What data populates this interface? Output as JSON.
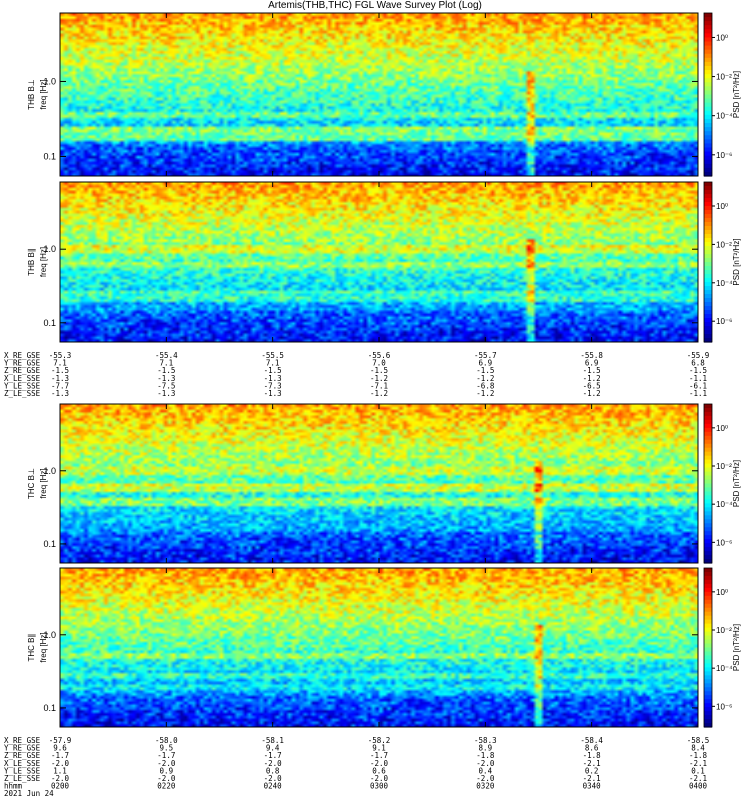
{
  "title": "Artemis(THB,THC) FGL Wave Survey Plot (Log)",
  "chart_data": [
    {
      "type": "heatmap",
      "ylabel": [
        "THB B⊥",
        "freq [Hz]"
      ],
      "colorbar_label": "PSD [nT²/Hz]",
      "y_scale": "log",
      "yticks": [
        "1.0",
        "0.1"
      ],
      "cticks": [
        "10⁰",
        "10⁻²",
        "10⁻⁴",
        "10⁻⁶"
      ]
    },
    {
      "type": "heatmap",
      "ylabel": [
        "THB B∥",
        "freq [Hz]"
      ],
      "colorbar_label": "PSD [nT²/Hz]",
      "y_scale": "log",
      "yticks": [
        "1.0",
        "0.1"
      ],
      "cticks": [
        "10⁰",
        "10⁻²",
        "10⁻⁴",
        "10⁻⁶"
      ]
    },
    {
      "type": "heatmap",
      "ylabel": [
        "THC B⊥",
        "freq [Hz]"
      ],
      "colorbar_label": "PSD [nT²/Hz]",
      "y_scale": "log",
      "yticks": [
        "1.0",
        "0.1"
      ],
      "cticks": [
        "10⁰",
        "10⁻²",
        "10⁻⁴",
        "10⁻⁶"
      ]
    },
    {
      "type": "heatmap",
      "ylabel": [
        "THC B∥",
        "freq [Hz]"
      ],
      "colorbar_label": "PSD [nT²/Hz]",
      "y_scale": "log",
      "yticks": [
        "1.0",
        "0.1"
      ],
      "cticks": [
        "10⁰",
        "10⁻²",
        "10⁻⁴",
        "10⁻⁶"
      ]
    }
  ],
  "ephem_thb": {
    "labels": [
      "X_RE_GSE",
      "Y_RE_GSE",
      "Z_RE_GSE",
      "X_LE_SSE",
      "Y_LE_SSE",
      "Z_LE_SSE"
    ],
    "rows": [
      [
        "-55.3",
        "-55.4",
        "-55.5",
        "-55.6",
        "-55.7",
        "-55.8",
        "-55.9"
      ],
      [
        "7.1",
        "7.1",
        "7.1",
        "7.0",
        "6.9",
        "6.9",
        "6.8"
      ],
      [
        "-1.5",
        "-1.5",
        "-1.5",
        "-1.5",
        "-1.5",
        "-1.5",
        "-1.5"
      ],
      [
        "-1.3",
        "-1.3",
        "-1.3",
        "-1.2",
        "-1.2",
        "-1.2",
        "-1.1"
      ],
      [
        "-7.7",
        "-7.5",
        "-7.3",
        "-7.1",
        "-6.8",
        "-6.5",
        "-6.1"
      ],
      [
        "-1.3",
        "-1.3",
        "-1.3",
        "-1.2",
        "-1.2",
        "-1.2",
        "-1.1"
      ]
    ]
  },
  "ephem_thc": {
    "labels": [
      "X_RE_GSE",
      "Y_RE_GSE",
      "Z_RE_GSE",
      "X_LE_SSE",
      "Y_LE_SSE",
      "Z_LE_SSE",
      "hhmm",
      "2021 Jun 24"
    ],
    "rows": [
      [
        "-57.9",
        "-58.0",
        "-58.1",
        "-58.2",
        "-58.3",
        "-58.4",
        "-58.5"
      ],
      [
        "9.6",
        "9.5",
        "9.4",
        "9.1",
        "8.9",
        "8.6",
        "8.4"
      ],
      [
        "-1.7",
        "-1.7",
        "-1.7",
        "-1.7",
        "-1.8",
        "-1.8",
        "-1.8"
      ],
      [
        "-2.0",
        "-2.0",
        "-2.0",
        "-2.0",
        "-2.0",
        "-2.1",
        "-2.1"
      ],
      [
        "1.1",
        "0.9",
        "0.8",
        "0.6",
        "0.4",
        "0.2",
        "0.1"
      ],
      [
        "-2.0",
        "-2.0",
        "-2.0",
        "-2.0",
        "-2.0",
        "-2.1",
        "-2.1"
      ],
      [
        "0200",
        "0220",
        "0240",
        "0300",
        "0320",
        "0340",
        "0400"
      ]
    ]
  },
  "colors": {
    "frame": "#000000",
    "gap": "#ffffff"
  }
}
